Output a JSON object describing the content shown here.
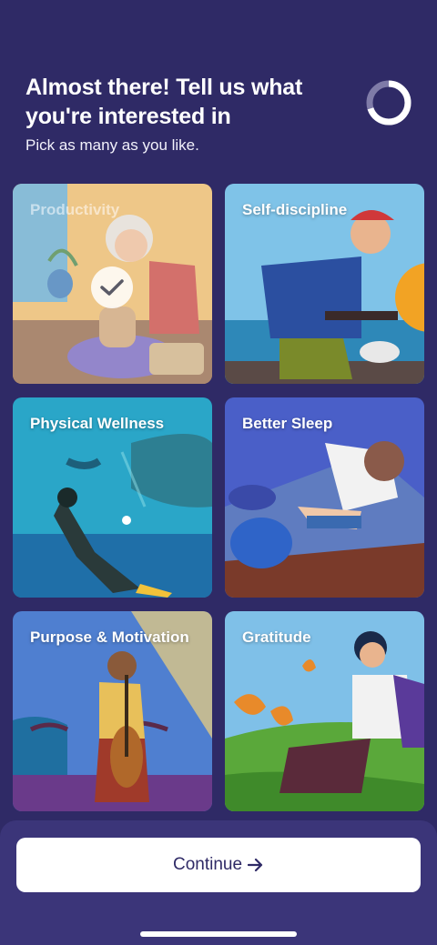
{
  "header": {
    "title": "Almost there! Tell us what you're interested in",
    "subtitle": "Pick as many as you like.",
    "progress": 0.7
  },
  "topics": [
    {
      "label": "Productivity",
      "selected": true
    },
    {
      "label": "Self-discipline",
      "selected": false
    },
    {
      "label": "Physical Wellness",
      "selected": false
    },
    {
      "label": "Better Sleep",
      "selected": false
    },
    {
      "label": "Purpose & Motivation",
      "selected": false
    },
    {
      "label": "Gratitude",
      "selected": false
    }
  ],
  "footer": {
    "continue_label": "Continue",
    "continue_icon": "arrow-right-icon"
  },
  "colors": {
    "background": "#2f2a66",
    "sheet": "#3b3579",
    "button": "#ffffff",
    "button_text": "#2f2a66"
  }
}
